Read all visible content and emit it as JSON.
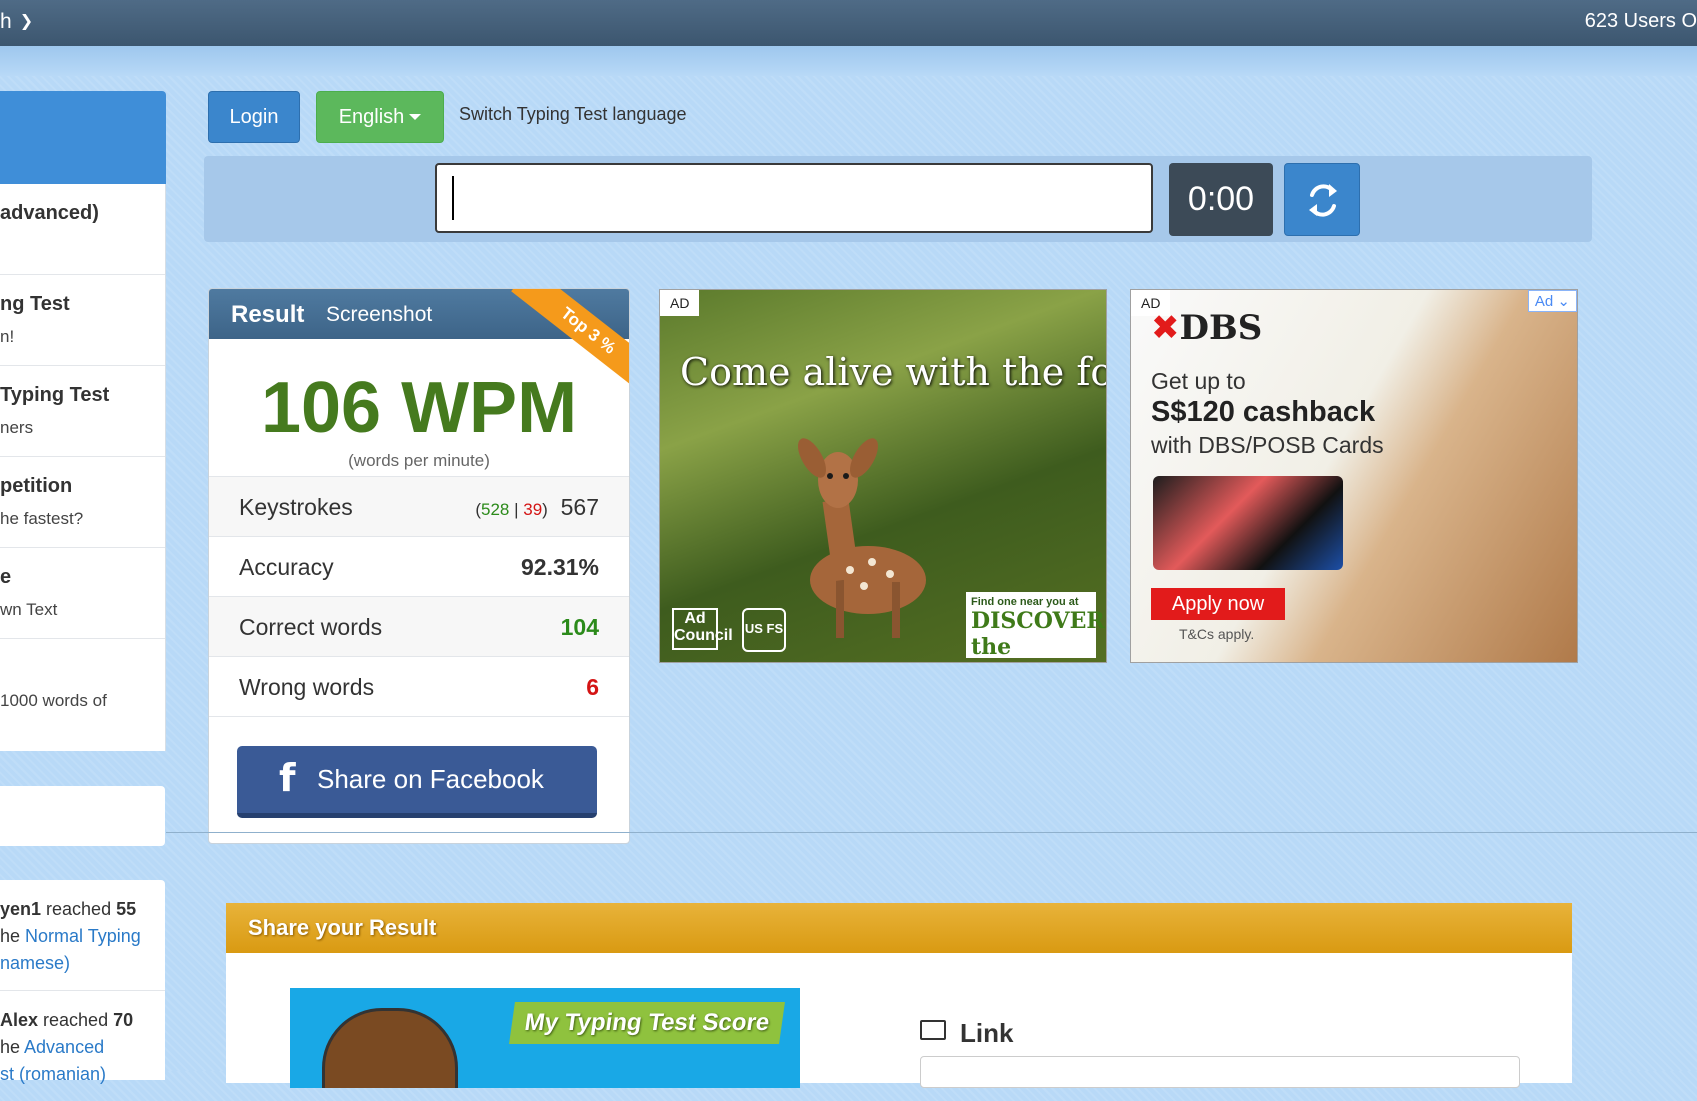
{
  "topbar": {
    "left_text": "h",
    "right_text": "623 Users O"
  },
  "sidebar": {
    "items": [
      {
        "title": "advanced)",
        "subtitle": ""
      },
      {
        "title": "ng Test",
        "subtitle": "n!"
      },
      {
        "title": "Typing Test",
        "subtitle": "ners"
      },
      {
        "title": "petition",
        "subtitle": "he fastest?"
      },
      {
        "title": "e",
        "subtitle": "wn Text"
      },
      {
        "title": "",
        "subtitle": "1000 words of"
      }
    ],
    "feed": [
      {
        "user": "yen1",
        "verb": " reached ",
        "score": "55",
        "line2_pre": "he ",
        "line2_link": "Normal Typing",
        "line3_link": "namese)"
      },
      {
        "user": "Alex",
        "verb": " reached ",
        "score": "70",
        "line2_pre": "he ",
        "line2_link": "Advanced",
        "line3_link": "st (romanian)"
      }
    ]
  },
  "controls": {
    "login_label": "Login",
    "language_label": "English",
    "language_note": "Switch Typing Test language",
    "input_value": "",
    "timer": "0:00"
  },
  "result": {
    "tab_result": "Result",
    "tab_screenshot": "Screenshot",
    "ribbon": "Top 3 %",
    "wpm": "106 WPM",
    "wpm_sub": "(words per minute)",
    "keystrokes_label": "Keystrokes",
    "keystrokes_correct": "528",
    "keystrokes_sep": " | ",
    "keystrokes_wrong": "39",
    "keystrokes_total": "567",
    "accuracy_label": "Accuracy",
    "accuracy_value": "92.31%",
    "correct_label": "Correct words",
    "correct_value": "104",
    "wrong_label": "Wrong words",
    "wrong_value": "6",
    "facebook_label": "Share on Facebook"
  },
  "ads": {
    "tag": "AD",
    "forest_title": "Come alive with the forest.",
    "forest_badge_small": "Find one near you at",
    "forest_badge_big": "DISCOVER the FOREST.org",
    "adcouncil": "Ad Council",
    "usfs": "US FS",
    "dbs_logo": "DBS",
    "dbs_line1": "Get up to",
    "dbs_line2": "S$120 cashback",
    "dbs_line3": "with DBS/POSB Cards",
    "dbs_apply": "Apply now",
    "dbs_tnc": "T&Cs apply.",
    "ad_choice": "Ad"
  },
  "share": {
    "title": "Share your Result",
    "image_tag": "My Typing Test Score",
    "link_label": "Link"
  },
  "colors": {
    "accent_blue": "#3b86cc",
    "success_green": "#5cb85c",
    "wpm_green": "#457a1e",
    "error_red": "#d41414",
    "share_gold": "#d99a12"
  }
}
